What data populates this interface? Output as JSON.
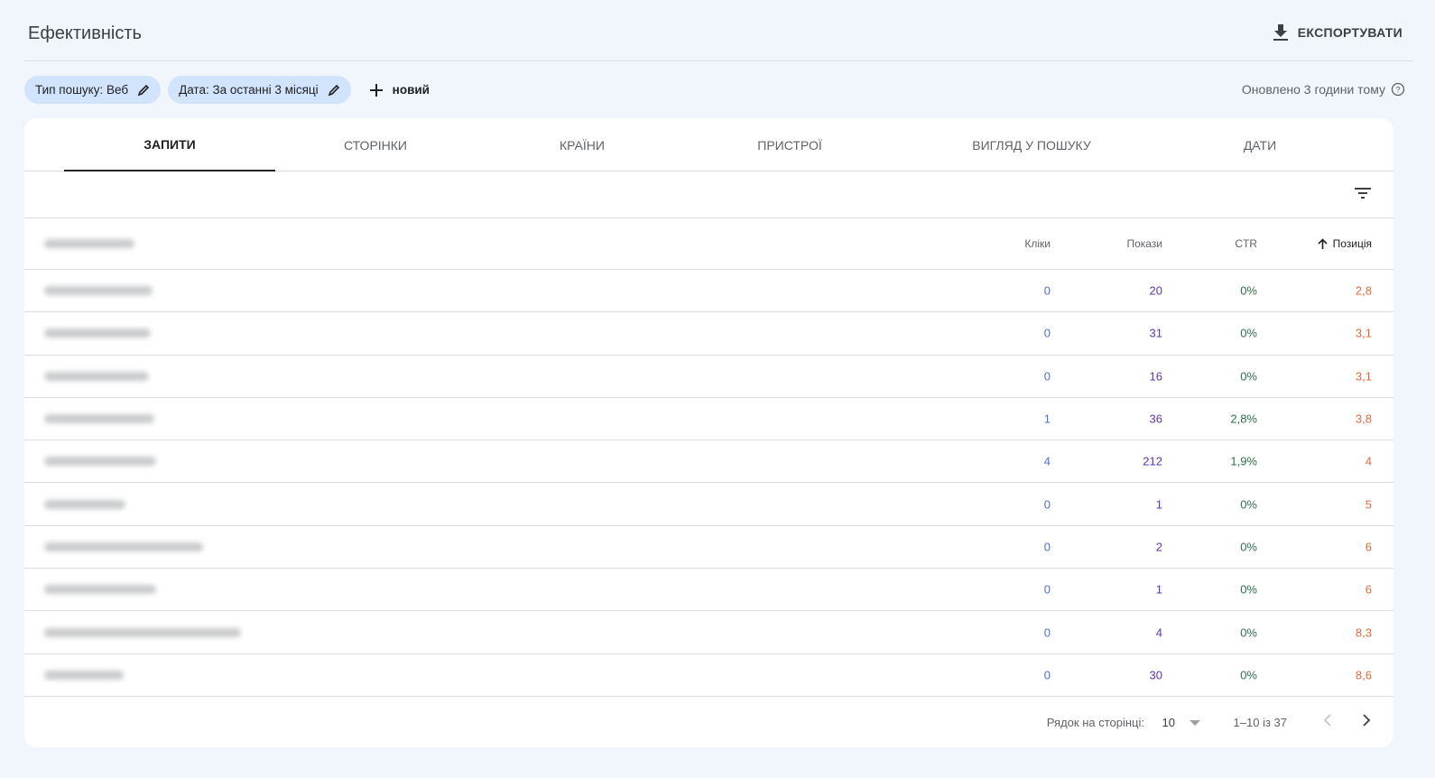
{
  "header": {
    "title": "Ефективність",
    "export_label": "ЕКСПОРТУВАТИ"
  },
  "filters": {
    "chips": [
      "Тип пошуку: Веб",
      "Дата: За останні 3 місяці"
    ],
    "new_label": "новий",
    "updated": "Оновлено 3 години тому"
  },
  "tabs": [
    "ЗАПИТИ",
    "СТОРІНКИ",
    "КРАЇНИ",
    "ПРИСТРОЇ",
    "ВИГЛЯД У ПОШУКУ",
    "ДАТИ"
  ],
  "table": {
    "columns": [
      "Кліки",
      "Покази",
      "CTR",
      "Позиція"
    ],
    "rows": [
      {
        "clicks": "0",
        "impressions": "20",
        "ctr": "0%",
        "position": "2,8"
      },
      {
        "clicks": "0",
        "impressions": "31",
        "ctr": "0%",
        "position": "3,1"
      },
      {
        "clicks": "0",
        "impressions": "16",
        "ctr": "0%",
        "position": "3,1"
      },
      {
        "clicks": "1",
        "impressions": "36",
        "ctr": "2,8%",
        "position": "3,8"
      },
      {
        "clicks": "4",
        "impressions": "212",
        "ctr": "1,9%",
        "position": "4"
      },
      {
        "clicks": "0",
        "impressions": "1",
        "ctr": "0%",
        "position": "5"
      },
      {
        "clicks": "0",
        "impressions": "2",
        "ctr": "0%",
        "position": "6"
      },
      {
        "clicks": "0",
        "impressions": "1",
        "ctr": "0%",
        "position": "6"
      },
      {
        "clicks": "0",
        "impressions": "4",
        "ctr": "0%",
        "position": "8,3"
      },
      {
        "clicks": "0",
        "impressions": "30",
        "ctr": "0%",
        "position": "8,6"
      }
    ]
  },
  "pagination": {
    "rows_label": "Рядок на сторінці:",
    "rows_value": "10",
    "range": "1–10 із 37"
  }
}
